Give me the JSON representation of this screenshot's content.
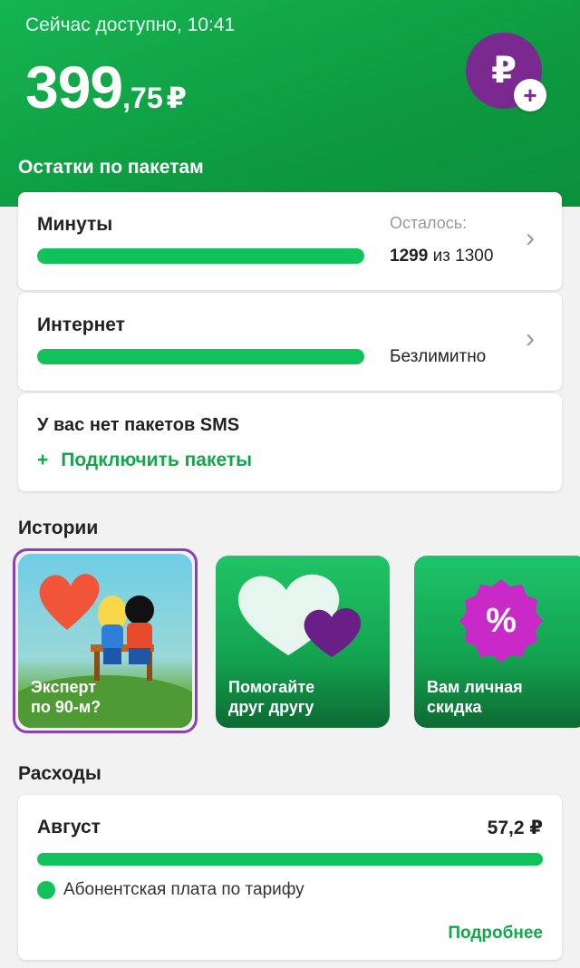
{
  "header": {
    "availability": "Сейчас доступно, 10:41",
    "balance_int": "399",
    "balance_frac": ",75",
    "currency": "₽",
    "topup_icon": "ruble-icon",
    "topup_plus": "+",
    "packages_title": "Остатки по пакетам"
  },
  "packages": {
    "minutes": {
      "title": "Минуты",
      "remaining_label": "Осталось:",
      "used": "1299",
      "of_word": "из",
      "total": "1300",
      "fill_fraction": 0.999
    },
    "internet": {
      "title": "Интернет",
      "value": "Безлимитно",
      "fill_fraction": 1
    },
    "sms": {
      "title": "У вас нет пакетов SMS",
      "add_plus": "+",
      "add_label": "Подключить пакеты"
    }
  },
  "stories": {
    "title": "Истории",
    "items": [
      {
        "label_line1": "Эксперт",
        "label_line2": "по 90-м?"
      },
      {
        "label_line1": "Помогайте",
        "label_line2": "друг другу"
      },
      {
        "label_line1": "Вам личная",
        "label_line2": "скидка"
      }
    ]
  },
  "expenses": {
    "title": "Расходы",
    "month": "Август",
    "sum": "57,2 ₽",
    "item": "Абонентская плата по тарифу",
    "more": "Подробнее"
  },
  "colors": {
    "brand_green": "#11c25a",
    "purple": "#7a2a8f"
  }
}
